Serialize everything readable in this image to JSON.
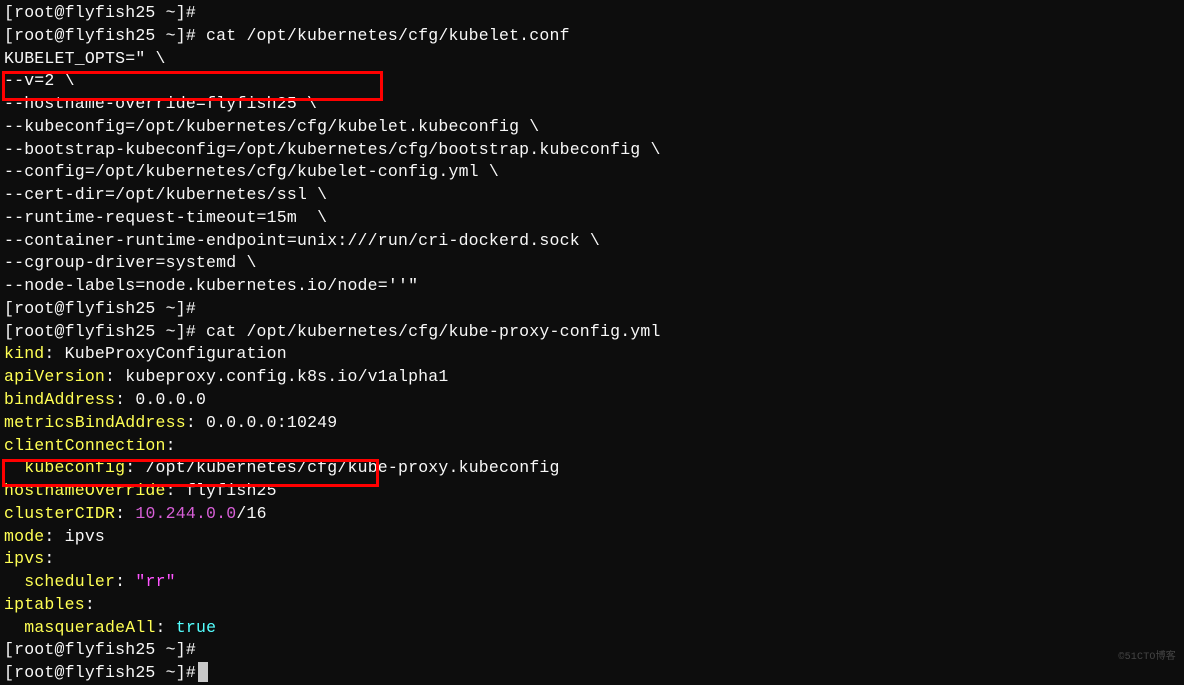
{
  "prompt1": "[root@flyfish25 ~]#",
  "prompt2": "[root@flyfish25 ~]# cat /opt/kubernetes/cfg/kubelet.conf",
  "kubelet": {
    "l1": "KUBELET_OPTS=\" \\",
    "l2": "--v=2 \\",
    "l3": "--hostname-override=flyfish25 \\",
    "l4": "--kubeconfig=/opt/kubernetes/cfg/kubelet.kubeconfig \\",
    "l5": "--bootstrap-kubeconfig=/opt/kubernetes/cfg/bootstrap.kubeconfig \\",
    "l6": "--config=/opt/kubernetes/cfg/kubelet-config.yml \\",
    "l7": "--cert-dir=/opt/kubernetes/ssl \\",
    "l8": "--runtime-request-timeout=15m  \\",
    "l9": "--container-runtime-endpoint=unix:///run/cri-dockerd.sock \\",
    "l10": "--cgroup-driver=systemd \\",
    "l11": "--node-labels=node.kubernetes.io/node=''\""
  },
  "prompt3": "[root@flyfish25 ~]#",
  "prompt4": "[root@flyfish25 ~]# cat /opt/kubernetes/cfg/kube-proxy-config.yml",
  "proxy": {
    "kind_k": "kind",
    "kind_v": ": KubeProxyConfiguration",
    "apiv_k": "apiVersion",
    "apiv_v": ": kubeproxy.config.k8s.io/v1alpha1",
    "bind_k": "bindAddress",
    "bind_v": ": 0.0.0.0",
    "metrics_k": "metricsBindAddress",
    "metrics_v": ": 0.0.0.0:10249",
    "cc_k": "clientConnection",
    "cc_v": ":",
    "kc_indent": "  ",
    "kc_k": "kubeconfig",
    "kc_v": ": /opt/kubernetes/cfg/kube-proxy.kubeconfig",
    "host_k": "hostnameOverride",
    "host_v": ": flyfish25",
    "cidr_k": "clusterCIDR",
    "cidr_colon": ": ",
    "cidr_ip": "10.244.0.0",
    "cidr_suffix": "/16",
    "mode_k": "mode",
    "mode_v": ": ipvs",
    "ipvs_k": "ipvs",
    "ipvs_v": ":",
    "sched_indent": "  ",
    "sched_k": "scheduler",
    "sched_colon": ": ",
    "sched_v": "\"rr\"",
    "ipt_k": "iptables",
    "ipt_v": ":",
    "masq_indent": "  ",
    "masq_k": "masqueradeAll",
    "masq_colon": ": ",
    "masq_v": "true"
  },
  "prompt5": "[root@flyfish25 ~]#",
  "prompt6": "[root@flyfish25 ~]#",
  "watermark": "©51CTO博客"
}
